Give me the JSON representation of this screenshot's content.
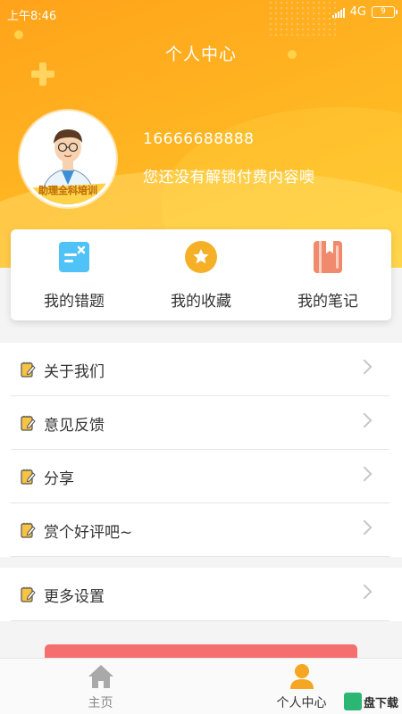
{
  "status_bar": {
    "time": "上午8:46",
    "network": "4G",
    "battery": "9"
  },
  "page_title": "个人中心",
  "profile": {
    "phone": "16666688888",
    "tip": "您还没有解锁付费内容噢",
    "avatar_caption": "助理全科培训"
  },
  "quick_actions": [
    {
      "label": "我的错题",
      "icon": "wrong-questions-icon",
      "color": "#4fc3f7"
    },
    {
      "label": "我的收藏",
      "icon": "star-icon",
      "color": "#f5b027"
    },
    {
      "label": "我的笔记",
      "icon": "notebook-icon",
      "color": "#f08a6c"
    }
  ],
  "menu": [
    {
      "label": "关于我们",
      "icon": "note-icon"
    },
    {
      "label": "意见反馈",
      "icon": "note-icon"
    },
    {
      "label": "分享",
      "icon": "note-icon"
    },
    {
      "label": "赏个好评吧~",
      "icon": "note-icon"
    }
  ],
  "menu2": [
    {
      "label": "更多设置",
      "icon": "note-icon"
    }
  ],
  "bottom_nav": [
    {
      "label": "主页",
      "icon": "home-icon",
      "active": false
    },
    {
      "label": "个人中心",
      "icon": "person-icon",
      "active": true
    }
  ],
  "watermark": "盘下载",
  "colors": {
    "accent": "#ffb321",
    "logout": "#f56f6f",
    "chevron": "#c6c6c6"
  }
}
